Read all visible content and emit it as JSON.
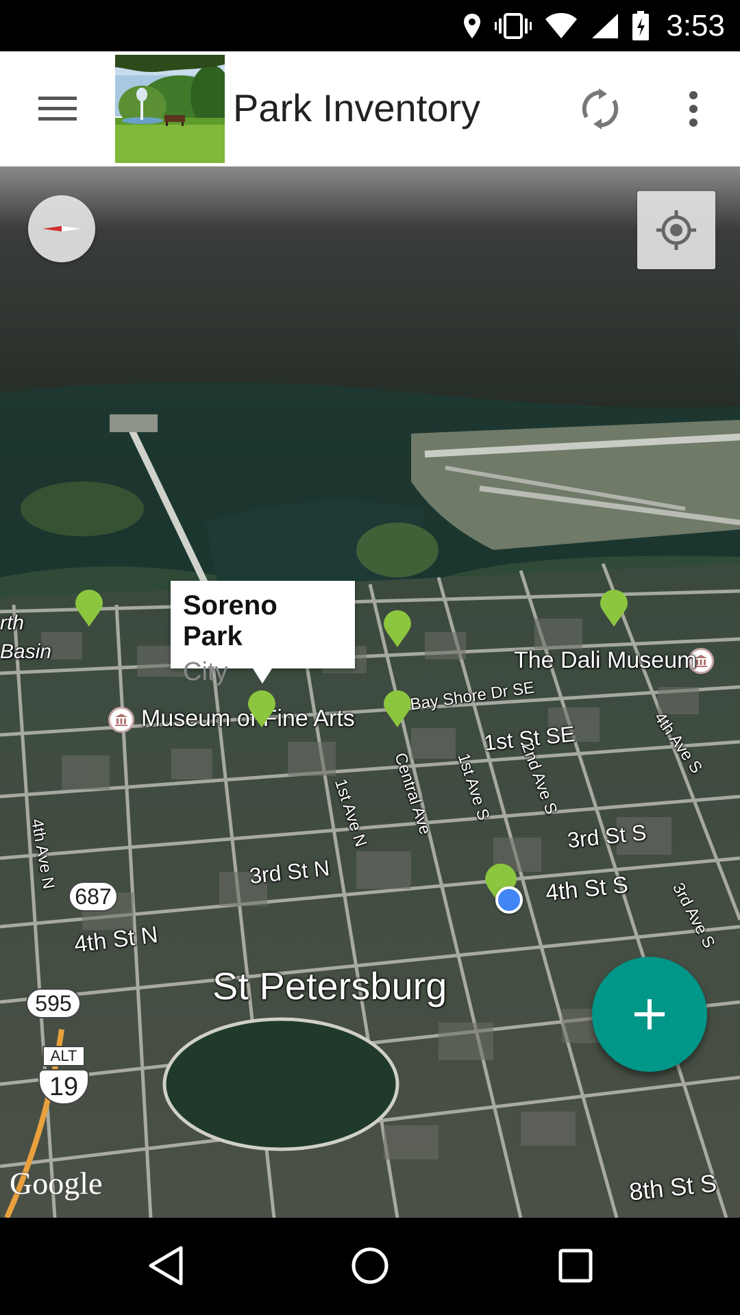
{
  "status_bar": {
    "time": "3:53",
    "icons": [
      "location-icon",
      "vibrate-icon",
      "wifi-icon",
      "signal-icon",
      "battery-charging-icon"
    ]
  },
  "app_bar": {
    "title": "Park Inventory",
    "menu_icon": "hamburger-menu-icon",
    "sync_icon": "sync-icon",
    "more_icon": "more-vert-icon"
  },
  "map": {
    "info_window": {
      "title": "Soreno Park",
      "subtitle": "City"
    },
    "labels": {
      "basin_1": "rth",
      "basin_2": "Basin",
      "dali_museum": "The Dali Museum",
      "museum_fine_arts": "Museum of Fine Arts",
      "bay_shore": "Bay Shore Dr SE",
      "first_st_se": "1st St SE",
      "fourth_ave_s": "4th Ave S",
      "central_ave": "Central Ave",
      "first_ave_s": "1st Ave S",
      "second_ave_s": "2nd Ave S",
      "first_ave_n": "1st Ave N",
      "fourth_ave_n": "4th Ave N",
      "third_st_s": "3rd St S",
      "fourth_st_s": "4th St S",
      "third_st_n": "3rd St N",
      "fourth_st_n": "4th St N",
      "third_ave_s": "3rd Ave S",
      "city": "St Petersburg",
      "eighth_st_s": "8th St S"
    },
    "shields": {
      "route_687": "687",
      "route_595": "595",
      "alt_label": "ALT",
      "route_19": "19"
    },
    "attribution": "Google",
    "accent_marker_color": "#8cc63f",
    "my_location_color": "#4285f4"
  },
  "fab": {
    "icon": "add-icon",
    "color": "#009688"
  },
  "nav_bar": {
    "back_icon": "back-icon",
    "home_icon": "home-icon",
    "recents_icon": "recents-icon"
  }
}
